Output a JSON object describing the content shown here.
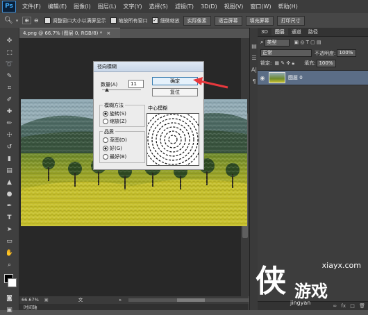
{
  "app": {
    "logo": "Ps"
  },
  "menu": [
    "文件(F)",
    "编辑(E)",
    "图像(I)",
    "图层(L)",
    "文字(Y)",
    "选择(S)",
    "滤镜(T)",
    "3D(D)",
    "视图(V)",
    "窗口(W)",
    "帮助(H)"
  ],
  "options": {
    "resize_windows": "调整窗口大小以满屏显示",
    "zoom_all": "缩放所有窗口",
    "scrubby_zoom": "细微缩放",
    "actual_pixels": "实际像素",
    "fit_screen": "适合屏幕",
    "fill_screen": "填充屏幕",
    "print_size": "打印尺寸"
  },
  "document": {
    "tab_title": "4.png @ 66.7% (图层 0, RGB/8) *",
    "zoom": "66.67%",
    "doc_info": "文档:1.37M/1.37M",
    "bottom_tab": "时间轴"
  },
  "panels": {
    "tabs": [
      "3D",
      "图层",
      "通道",
      "路径"
    ],
    "kind_filter": "类型",
    "blend_mode": "正常",
    "opacity_label": "不透明度:",
    "opacity_value": "100%",
    "lock_label": "锁定:",
    "fill_label": "填充:",
    "fill_value": "100%",
    "layer_name": "图层 0"
  },
  "dialog": {
    "title": "径向模糊",
    "amount_label": "数量(A)",
    "amount_value": "11",
    "ok": "确定",
    "reset": "复位",
    "method_label": "模糊方法",
    "method_spin": "旋转(S)",
    "method_zoom": "缩放(Z)",
    "quality_label": "品质",
    "quality_draft": "草图(D)",
    "quality_good": "好(G)",
    "quality_best": "最好(B)",
    "center_label": "中心模糊"
  },
  "watermark": {
    "site": "xiayx.com",
    "brand_glyph": "侠",
    "brand_text": "游戏",
    "sub": "jingyan"
  },
  "colors": {
    "accent": "#3fa9f5",
    "arrow": "#e8383d",
    "dialog_bg": "#ececec"
  }
}
